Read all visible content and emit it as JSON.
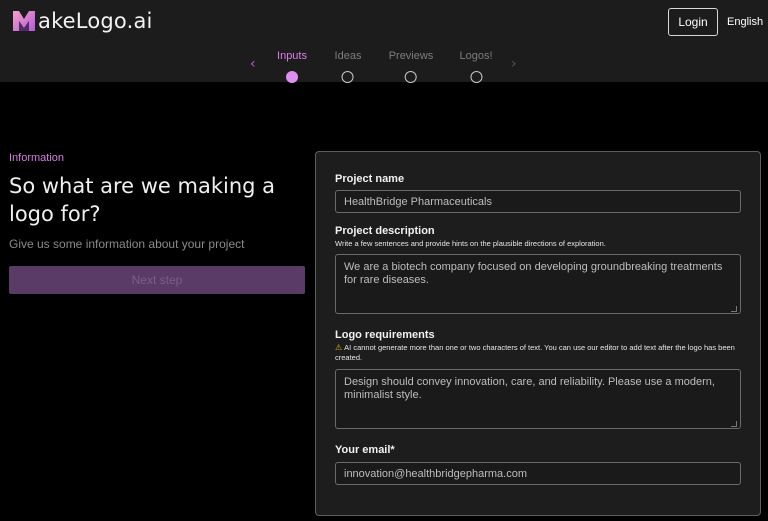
{
  "header": {
    "logo_text": "akeLogo.ai",
    "login_label": "Login",
    "language": "English",
    "brand_colors": {
      "pink": "#f08ab8",
      "purple": "#b45bd8"
    }
  },
  "steps": {
    "prev_icon": "chevron-left-icon",
    "next_icon": "chevron-right-icon",
    "items": [
      {
        "label": "Inputs",
        "active": true
      },
      {
        "label": "Ideas",
        "active": false
      },
      {
        "label": "Previews",
        "active": false
      },
      {
        "label": "Logos!",
        "active": false
      }
    ]
  },
  "intro": {
    "eyebrow": "Information",
    "headline": "So what are we making a logo for?",
    "subtext": "Give us some information about your project",
    "next_label": "Next step"
  },
  "form": {
    "project_name": {
      "label": "Project name",
      "value": "HealthBridge Pharmaceuticals"
    },
    "project_description": {
      "label": "Project description",
      "hint": "Write a few sentences and provide hints on the plausible directions of exploration.",
      "value": "We are a biotech company focused on developing groundbreaking treatments for rare diseases."
    },
    "logo_requirements": {
      "label": "Logo requirements",
      "warning_icon": "warning-icon",
      "hint": "AI cannot generate more than one or two characters of text. You can use our editor to add text after the logo has been created.",
      "value": "Design should convey innovation, care, and reliability. Please use a modern, minimalist style."
    },
    "email": {
      "label": "Your email*",
      "value": "innovation@healthbridgepharma.com"
    }
  },
  "colors": {
    "accent": "#d77fe6",
    "button_disabled": "#5a3a66",
    "card_bg": "#1d1d1d"
  }
}
